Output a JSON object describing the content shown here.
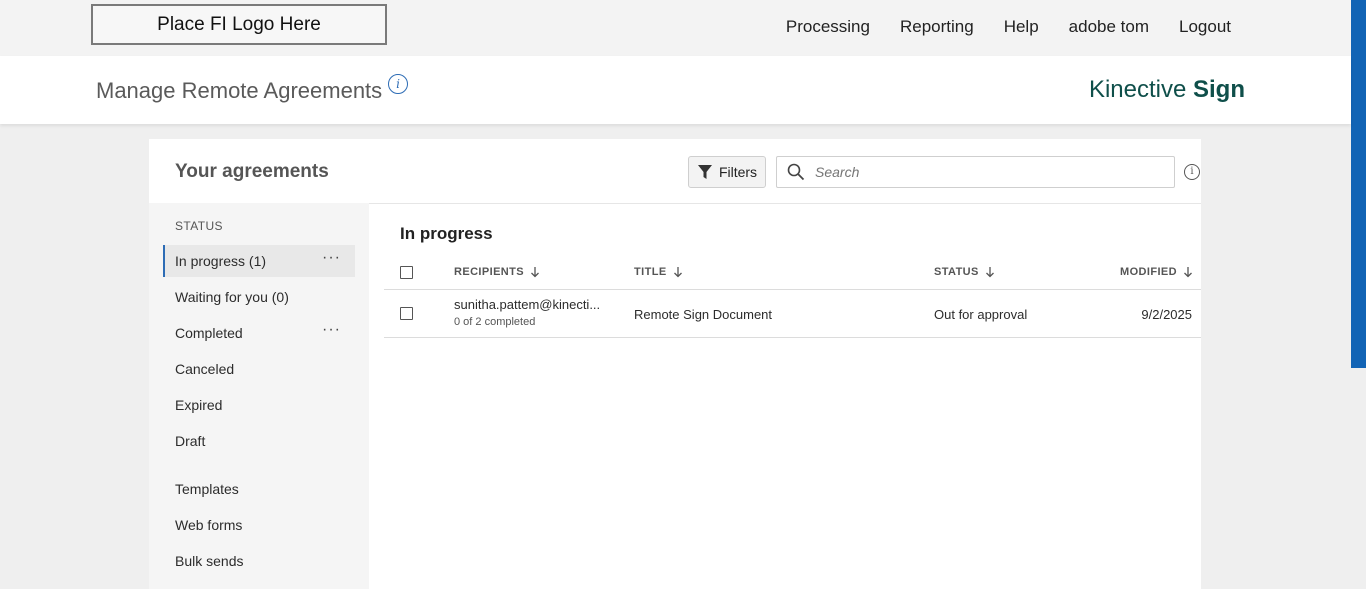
{
  "topbar": {
    "logo_text": "Place FI Logo Here",
    "nav": [
      "Processing",
      "Reporting",
      "Help",
      "adobe tom",
      "Logout"
    ]
  },
  "subheader": {
    "title": "Manage Remote Agreements",
    "info_glyph": "i",
    "brand_light": "Kinective",
    "brand_bold": "Sign"
  },
  "agreements": {
    "heading": "Your agreements",
    "filters_label": "Filters",
    "search_placeholder": "Search",
    "sidebar": {
      "status_label": "STATUS",
      "items": [
        {
          "label": "In progress (1)",
          "active": true,
          "menu": true
        },
        {
          "label": "Waiting for you (0)"
        },
        {
          "label": "Completed",
          "menu": true
        },
        {
          "label": "Canceled"
        },
        {
          "label": "Expired"
        },
        {
          "label": "Draft"
        },
        {
          "label": "Templates"
        },
        {
          "label": "Web forms"
        },
        {
          "label": "Bulk sends"
        }
      ],
      "menu_glyph": "···"
    },
    "list": {
      "section_title": "In progress",
      "columns": [
        "RECIPIENTS",
        "TITLE",
        "STATUS",
        "MODIFIED"
      ],
      "rows": [
        {
          "recipient": "sunitha.pattem@kinecti...",
          "progress": "0 of 2 completed",
          "title": "Remote Sign Document",
          "status": "Out for approval",
          "modified": "9/2/2025"
        }
      ]
    }
  },
  "colors": {
    "accent": "#2d6cb5",
    "brand": "#0f4f4a",
    "scroll_accent": "#1264b5"
  }
}
